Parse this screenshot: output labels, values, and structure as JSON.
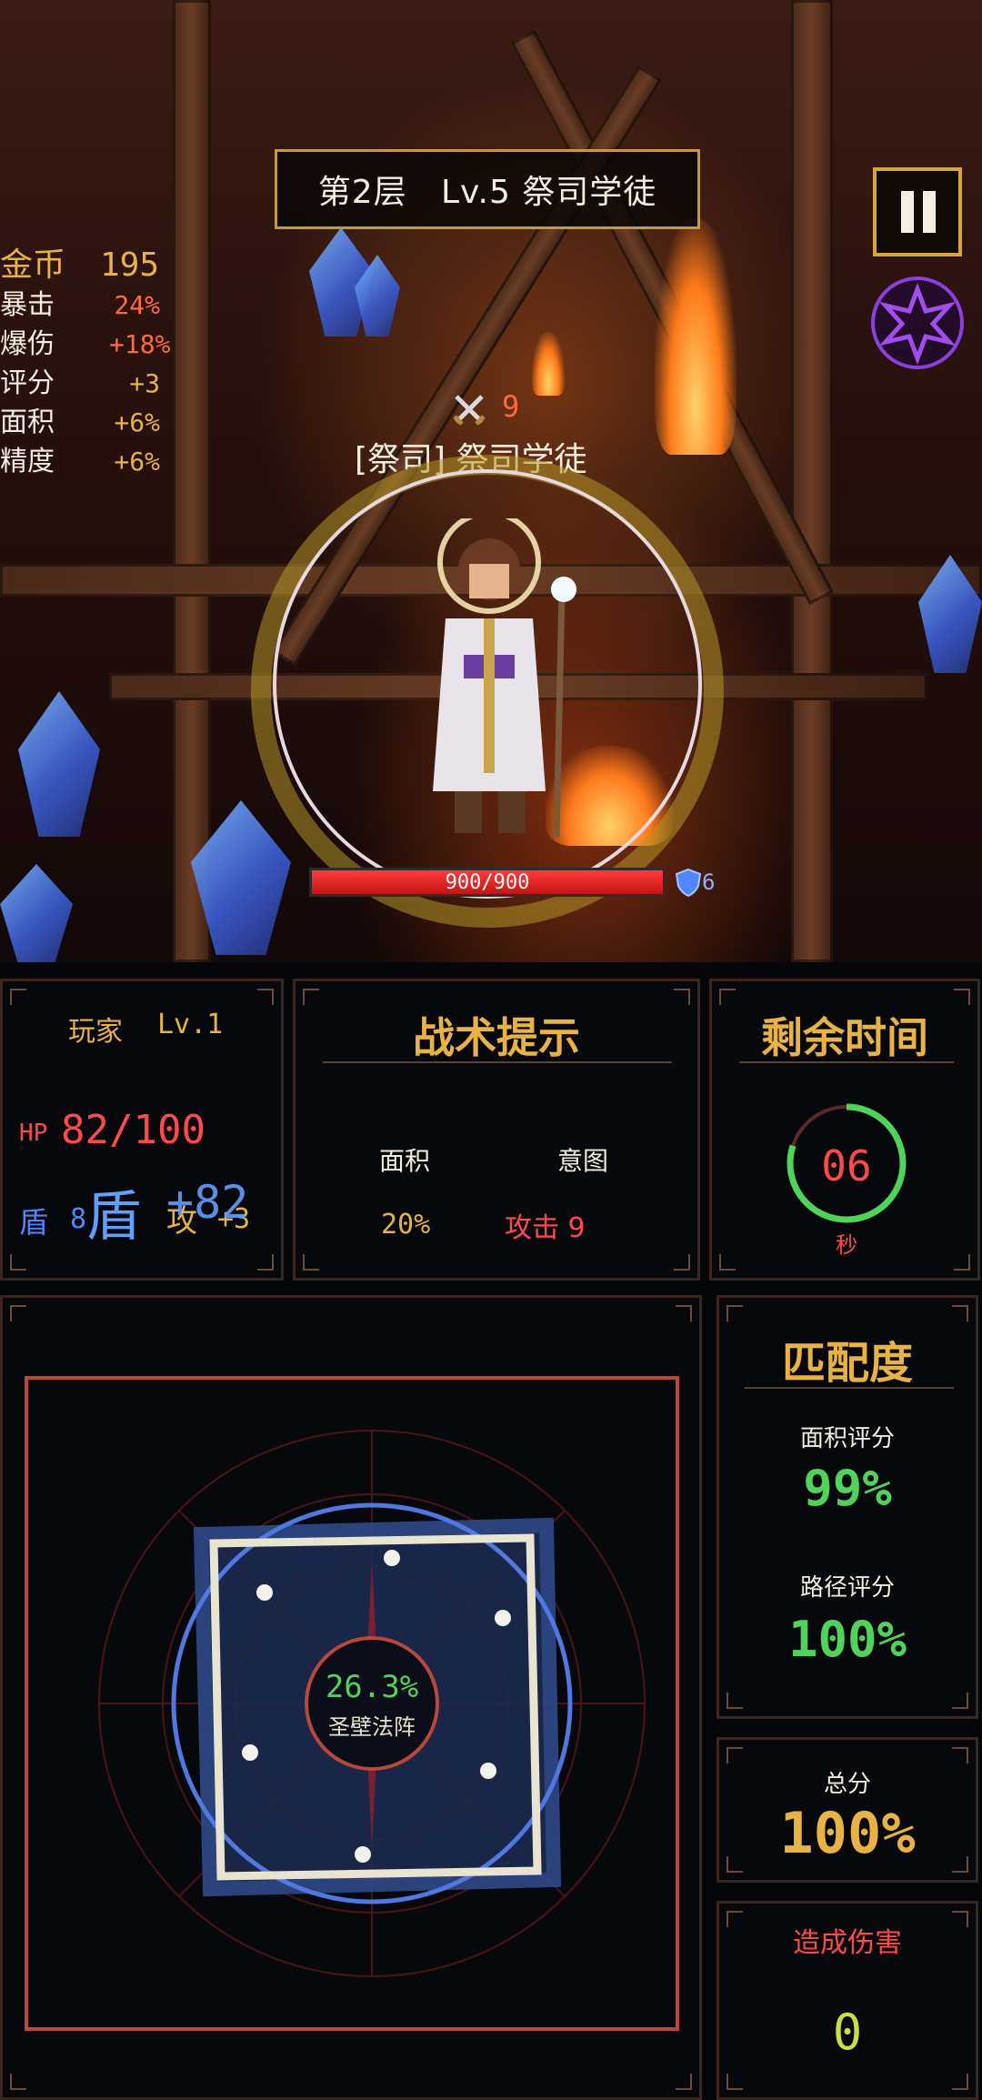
{
  "header": {
    "level_text": "第2层   Lv.5 祭司学徒"
  },
  "stats": {
    "gold_label": "金币",
    "gold_value": "195",
    "rows": [
      {
        "label": "暴击",
        "value": "24%"
      },
      {
        "label": "爆伤",
        "value": "+18%"
      },
      {
        "label": "评分",
        "value": "+3"
      },
      {
        "label": "面积",
        "value": "+6%"
      },
      {
        "label": "精度",
        "value": "+6%"
      }
    ]
  },
  "enemy": {
    "intent_value": "9",
    "name": "[祭司] 祭司学徒",
    "hp_text": "900/900",
    "hp_fraction": 1.0,
    "shield_value": "6"
  },
  "player_panel": {
    "label": "玩家",
    "level": "Lv.1",
    "hp_label": "HP",
    "hp_value": "82/100",
    "shield_label": "盾",
    "shield_value": "8",
    "big_shield": "盾",
    "big_number": "+82",
    "attack_label": "攻",
    "attack_value": "+3"
  },
  "tactics_panel": {
    "title": "战术提示",
    "col1_label": "面积",
    "col1_value": "20%",
    "col2_label": "意图",
    "col2_value": "攻击 9"
  },
  "timer_panel": {
    "title": "剩余时间",
    "value": "06",
    "unit": "秒",
    "progress": 0.8
  },
  "formation": {
    "percent": "26.3%",
    "name": "圣壁法阵"
  },
  "match_panel": {
    "title": "匹配度",
    "area_label": "面积评分",
    "area_value": "99%",
    "path_label": "路径评分",
    "path_value": "100%"
  },
  "total_panel": {
    "label": "总分",
    "value": "100%"
  },
  "damage_panel": {
    "label": "造成伤害",
    "value": "0"
  },
  "colors": {
    "gold": "#e9b245",
    "green": "#4fd45a",
    "red": "#ff4a4a",
    "blue": "#4f86ff"
  },
  "icons": [
    "pause-icon",
    "star-skill-icon",
    "crossed-swords-icon",
    "shield-icon"
  ]
}
